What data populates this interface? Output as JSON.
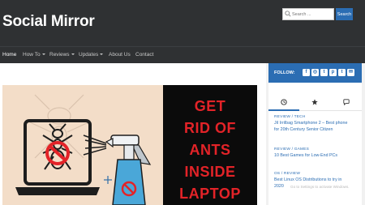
{
  "header": {
    "site_title": "Social Mirror",
    "search_placeholder": "Search ...",
    "search_button": "Search"
  },
  "nav": [
    {
      "label": "Home",
      "dropdown": false,
      "active": true
    },
    {
      "label": "How To",
      "dropdown": true
    },
    {
      "label": "Reviews",
      "dropdown": true
    },
    {
      "label": "Updates",
      "dropdown": true
    },
    {
      "label": "About Us",
      "dropdown": false
    },
    {
      "label": "Contact",
      "dropdown": false
    }
  ],
  "hero": {
    "text_lines": [
      "GET",
      "RID OF",
      "ANTS",
      "INSIDE",
      "LAPTOP"
    ],
    "text_color": "#e32328",
    "background_left": "#f3ddc8",
    "background_right": "#0b0b0b"
  },
  "sidebar": {
    "follow_label": "FOLLOW:",
    "social_icons": [
      "facebook-icon",
      "instagram-icon",
      "twitter-icon",
      "pinterest-icon",
      "tumblr-icon",
      "email-icon"
    ],
    "tabs": [
      "clock-icon",
      "star-icon",
      "comment-icon"
    ],
    "posts": [
      {
        "category": "REVIEW / TECH",
        "title_lines": [
          "JiI Irrilbag Smartphone 2 – Best phone",
          "for 20th Century Senior Citizen"
        ]
      },
      {
        "category": "REVIEW / GAMES",
        "title_lines": [
          "10 Best Games for Low-End PCs"
        ]
      },
      {
        "category": "OS / REVIEW",
        "title_lines": [
          "Best Linux OS Distributions to try in",
          "2020"
        ]
      }
    ],
    "watermark": "Go to Settings to activate Windows."
  },
  "colors": {
    "header_bg": "#2f3133",
    "accent": "#2b6db3"
  }
}
